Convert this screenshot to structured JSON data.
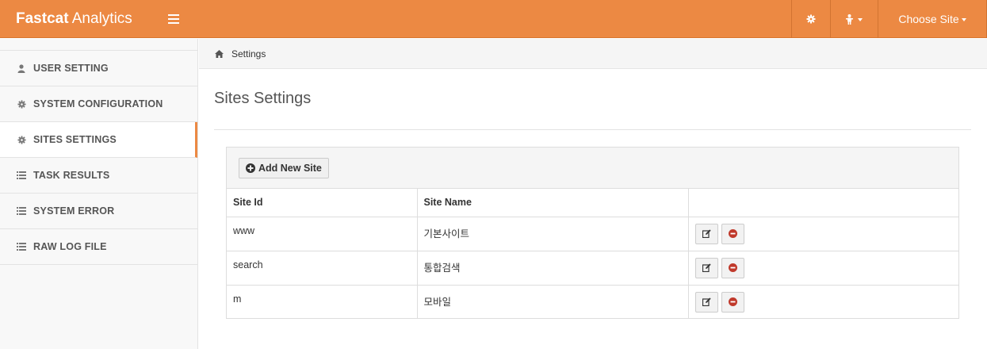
{
  "navbar": {
    "brand_bold": "Fastcat",
    "brand_rest": " Analytics",
    "site_menu_label": "Choose Site",
    "brand_color": "#ec8943"
  },
  "sidebar": {
    "items": [
      {
        "label": "USER SETTING",
        "icon": "user-icon",
        "active": false
      },
      {
        "label": "SYSTEM CONFIGURATION",
        "icon": "gear-icon",
        "active": false
      },
      {
        "label": "SITES SETTINGS",
        "icon": "gear-icon",
        "active": true
      },
      {
        "label": "TASK RESULTS",
        "icon": "list-icon",
        "active": false
      },
      {
        "label": "SYSTEM ERROR",
        "icon": "list-icon",
        "active": false
      },
      {
        "label": "RAW LOG FILE",
        "icon": "list-icon",
        "active": false
      }
    ]
  },
  "breadcrumb": {
    "icon": "home-icon",
    "current": "Settings"
  },
  "main": {
    "title": "Sites Settings",
    "add_button_label": "Add New Site",
    "table": {
      "headers": [
        "Site Id",
        "Site Name",
        ""
      ],
      "rows": [
        {
          "site_id": "www",
          "site_name": "기본사이트"
        },
        {
          "site_id": "search",
          "site_name": "통합검색"
        },
        {
          "site_id": "m",
          "site_name": "모바일"
        }
      ]
    }
  }
}
